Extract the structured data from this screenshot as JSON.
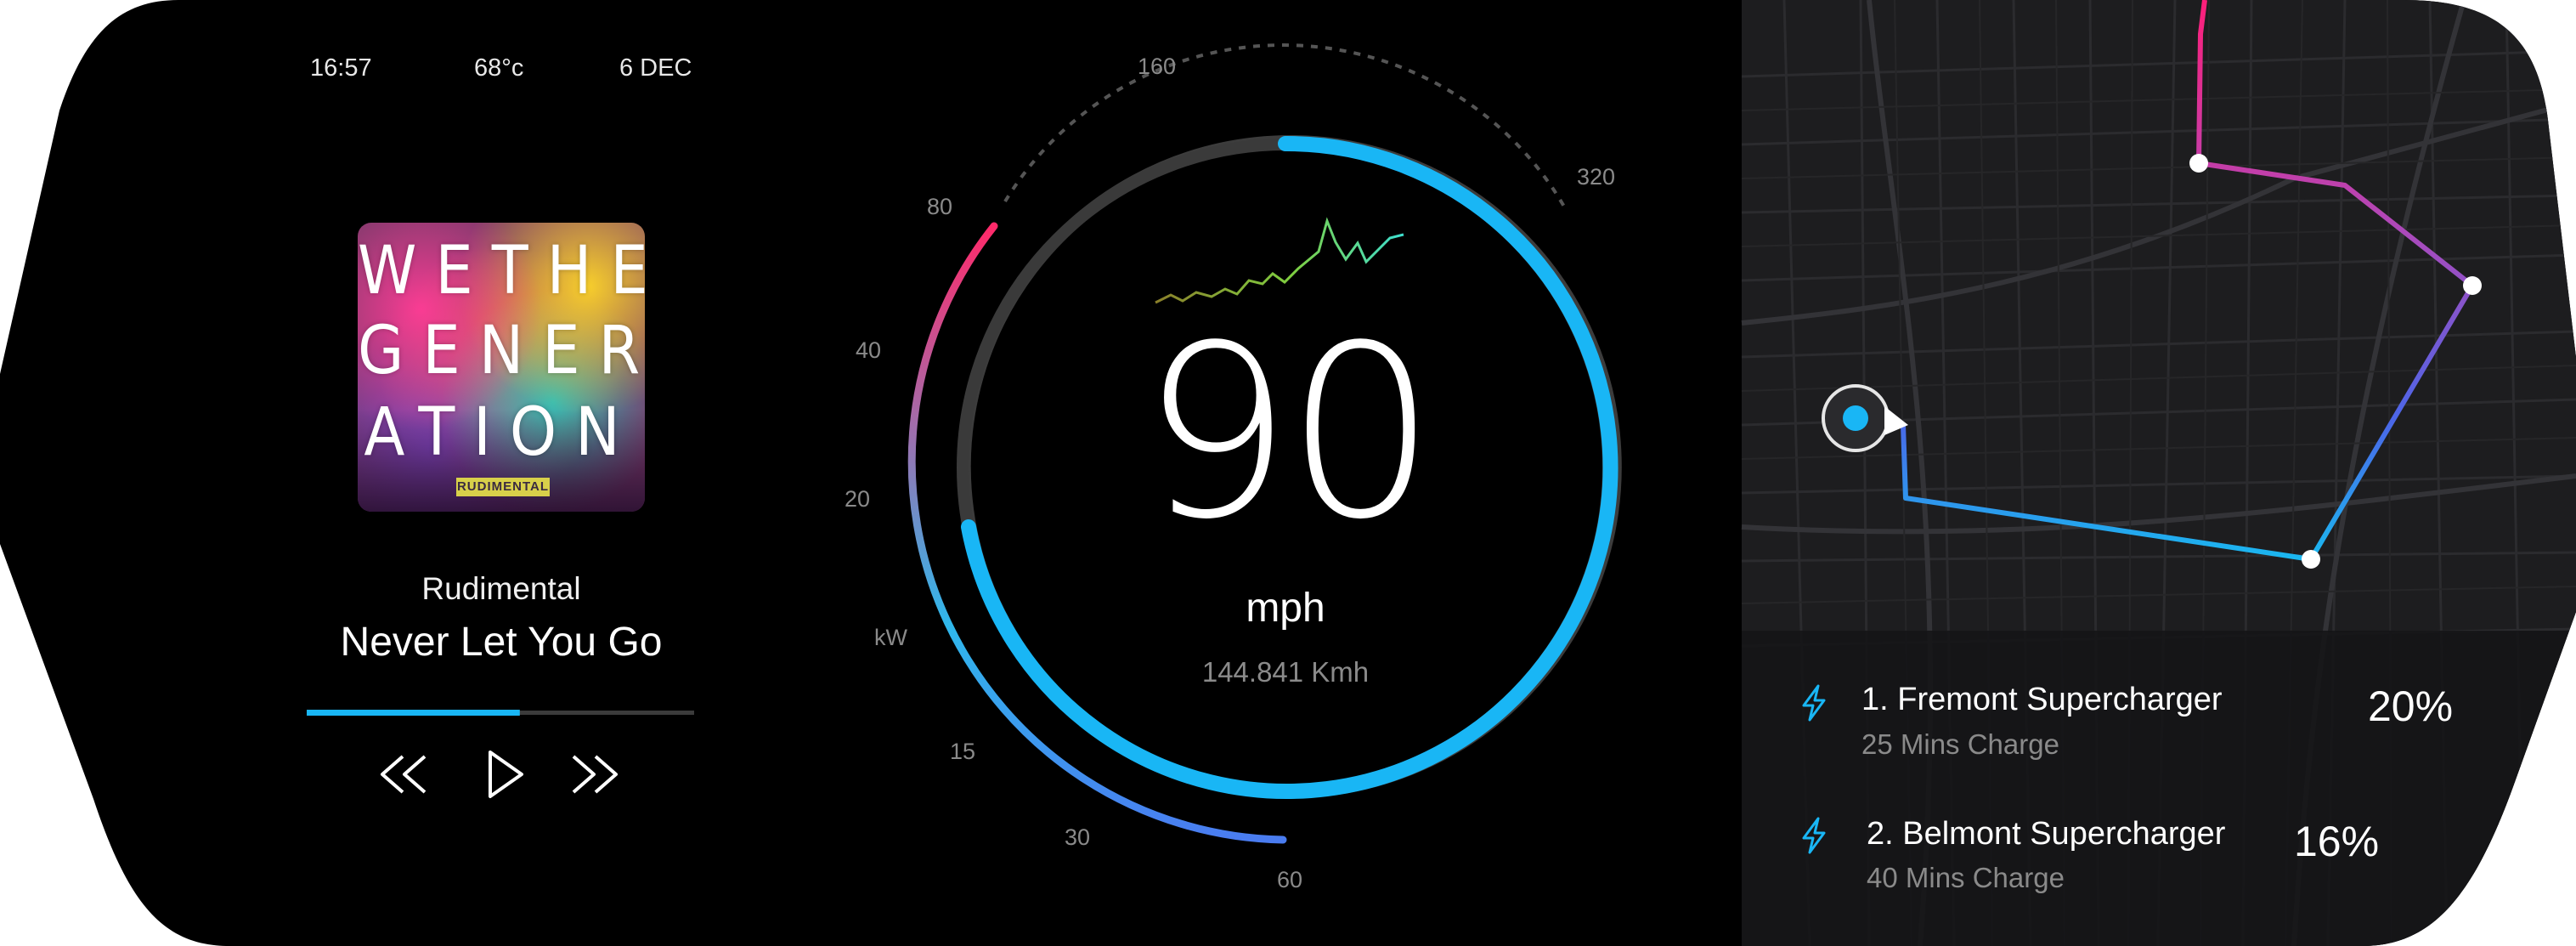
{
  "status_bar": {
    "time": "16:57",
    "temperature": "68°c",
    "date": "6 DEC"
  },
  "music": {
    "album_art": {
      "lines": [
        "WETHE",
        "GENER",
        "ATION"
      ],
      "band_tag": "RUDIMENTAL"
    },
    "artist": "Rudimental",
    "track": "Never Let You Go",
    "progress": 0.55
  },
  "player_controls": {
    "rewind_icon": "rewind-icon",
    "play_icon": "play-icon",
    "fast_forward_icon": "fast-forward-icon"
  },
  "speedometer": {
    "speed": "90",
    "unit": "mph",
    "kmh": "144.841 Kmh",
    "speed_scale": [
      "160",
      "320"
    ],
    "power_unit": "kW",
    "power_scale": [
      "80",
      "40",
      "20",
      "15",
      "30",
      "60"
    ]
  },
  "navigation": {
    "stations": [
      {
        "name": "1. Fremont Supercharger",
        "detail": "25 Mins Charge",
        "charge": "20%",
        "icon": "lightning-icon"
      },
      {
        "name": "2. Belmont Supercharger",
        "detail": "40 Mins Charge",
        "charge": "16%",
        "icon": "lightning-icon"
      }
    ]
  },
  "colors": {
    "accent_blue": "#19b6f5",
    "route_pink": "#e8257a",
    "background": "#000000",
    "map_background": "#1c1c1e"
  }
}
